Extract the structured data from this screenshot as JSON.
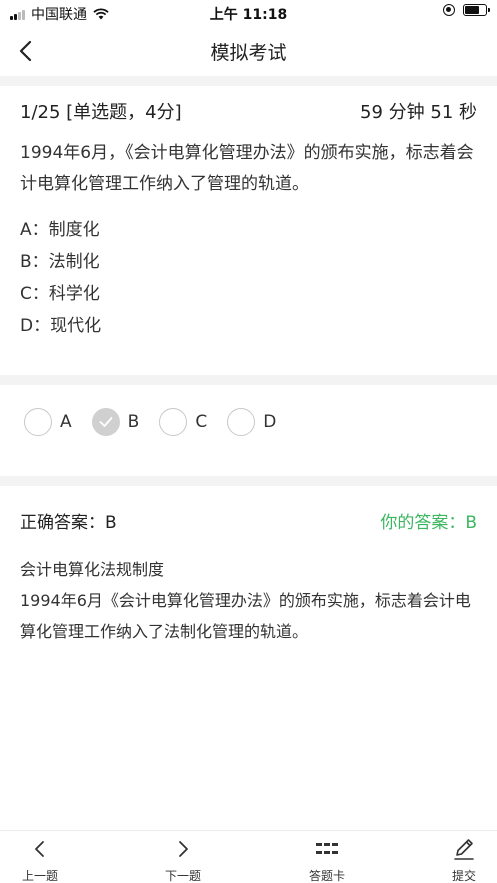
{
  "status_bar": {
    "carrier": "中国联通",
    "time": "上午 11:18"
  },
  "nav": {
    "title": "模拟考试"
  },
  "question": {
    "progress": "1/25",
    "type": "[单选题，4分]",
    "timer": "59 分钟 51 秒",
    "text": "1994年6月，《会计电算化管理办法》的颁布实施，标志着会计电算化管理工作纳入了管理的轨道。",
    "options": [
      {
        "label": "A：制度化"
      },
      {
        "label": "B：法制化"
      },
      {
        "label": "C：科学化"
      },
      {
        "label": "D：现代化"
      }
    ]
  },
  "answer_choices": [
    {
      "letter": "A",
      "selected": false
    },
    {
      "letter": "B",
      "selected": true
    },
    {
      "letter": "C",
      "selected": false
    },
    {
      "letter": "D",
      "selected": false
    }
  ],
  "result": {
    "correct_answer": "正确答案：B",
    "your_answer": "你的答案：B",
    "your_answer_color": "#3cb760",
    "explanation_title": "会计电算化法规制度",
    "explanation_text": "1994年6月《会计电算化管理办法》的颁布实施，标志着会计电算化管理工作纳入了法制化管理的轨道。"
  },
  "bottom_bar": {
    "prev_label": "上一题",
    "next_label": "下一题",
    "card_label": "答题卡",
    "submit_label": "提交"
  }
}
